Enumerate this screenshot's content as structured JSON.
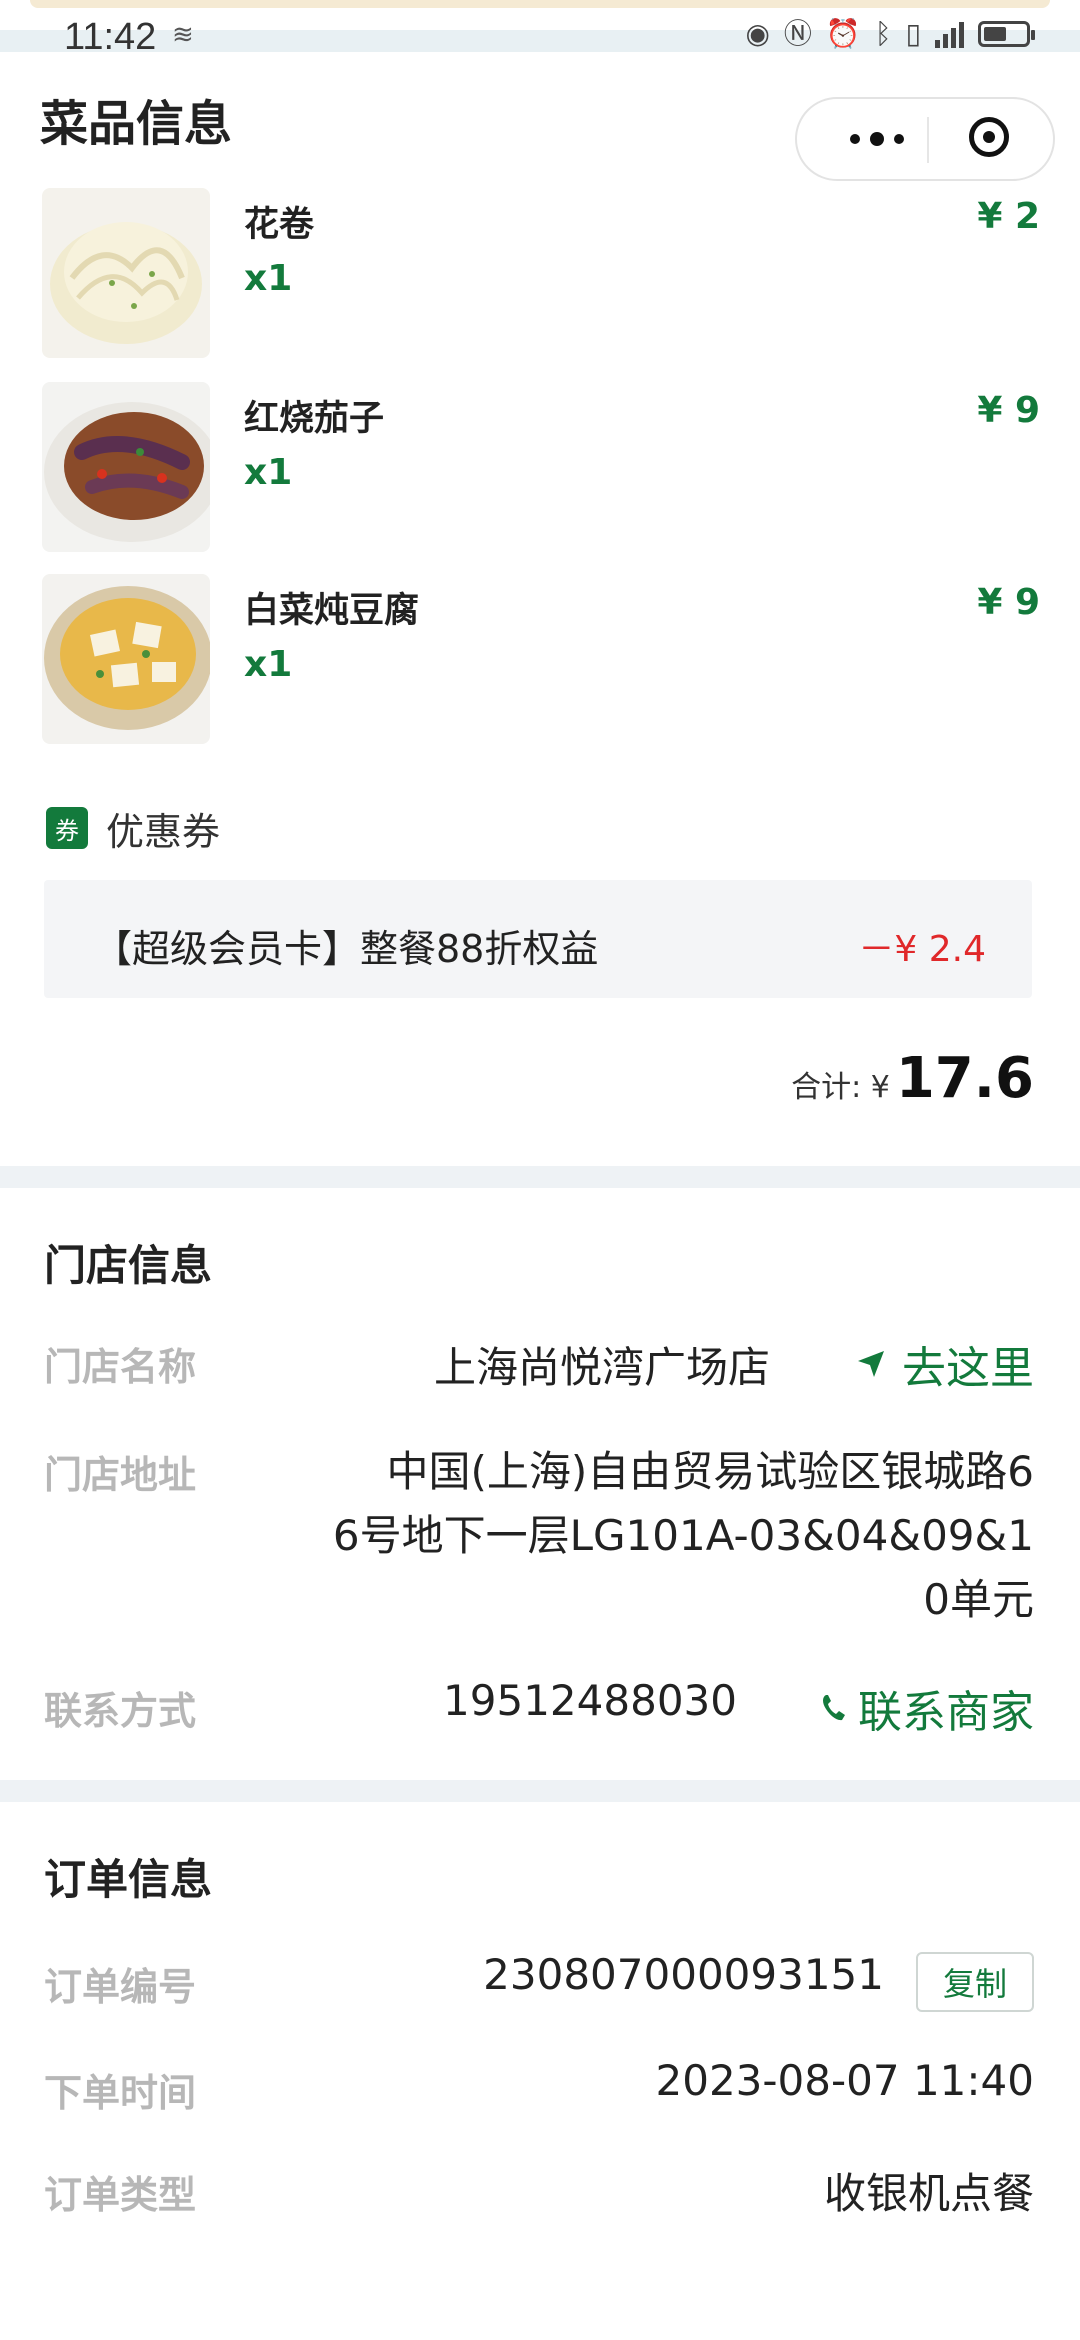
{
  "status_bar": {
    "time": "11:42"
  },
  "header": {
    "title": "菜品信息"
  },
  "dishes": [
    {
      "name": "花卷",
      "qty": "x1",
      "price": "¥ 2",
      "image": "steamed-flower-roll"
    },
    {
      "name": "红烧茄子",
      "qty": "x1",
      "price": "¥ 9",
      "image": "braised-eggplant"
    },
    {
      "name": "白菜炖豆腐",
      "qty": "x1",
      "price": "¥ 9",
      "image": "cabbage-tofu-stew"
    }
  ],
  "coupon": {
    "tag": "券",
    "title": "优惠券",
    "name": "【超级会员卡】整餐88折权益",
    "discount": "－¥ 2.4"
  },
  "total": {
    "label": "合计: ¥",
    "value": "17.6"
  },
  "store": {
    "title": "门店信息",
    "name_label": "门店名称",
    "name": "上海尚悦湾广场店",
    "navigate": "去这里",
    "address_label": "门店地址",
    "address_lines": [
      "中国(上海)自由贸易试验区银城路6",
      "6号地下一层LG101A-03&04&09&1",
      "0单元"
    ],
    "contact_label": "联系方式",
    "phone": "19512488030",
    "contact_action": "联系商家"
  },
  "order": {
    "title": "订单信息",
    "number_label": "订单编号",
    "number": "230807000093151",
    "copy": "复制",
    "time_label": "下单时间",
    "time": "2023-08-07 11:40",
    "type_label": "订单类型",
    "type": "收银机点餐"
  },
  "colors": {
    "accent": "#137a3c",
    "discount": "#e0282a",
    "muted_label": "#b7b7b7"
  }
}
